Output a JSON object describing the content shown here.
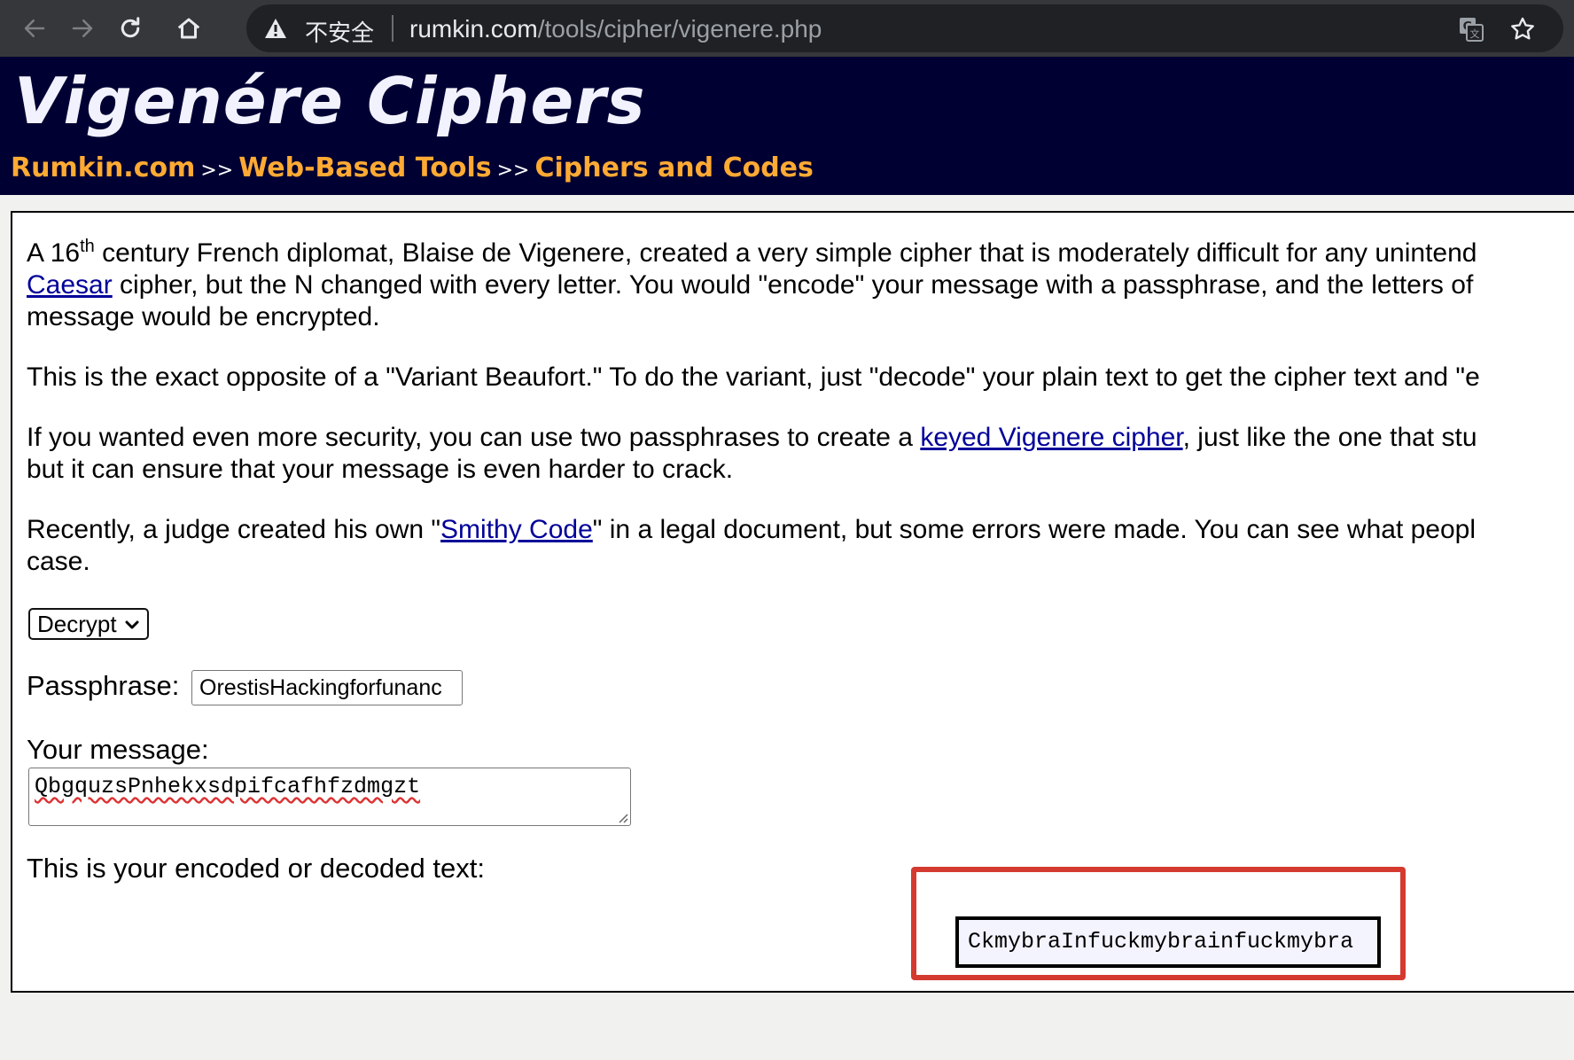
{
  "browser": {
    "security_label": "不安全",
    "url_host": "rumkin.com",
    "url_path": "/tools/cipher/vigenere.php"
  },
  "header": {
    "title": "Vigenére Ciphers",
    "breadcrumb": [
      "Rumkin.com",
      "Web-Based Tools",
      "Ciphers and Codes"
    ],
    "breadcrumb_separator": ">>"
  },
  "content": {
    "p1": {
      "a": "A 16",
      "sup": "th",
      "b": " century French diplomat, Blaise de Vigenere, created a very simple cipher that is moderately difficult for any unintend",
      "link": "Caesar",
      "c": " cipher, but the N changed with every letter. You would \"encode\" your message with a passphrase, and the letters of",
      "d": "message would be encrypted."
    },
    "p2": "This is the exact opposite of a \"Variant Beaufort.\" To do the variant, just \"decode\" your plain text to get the cipher text and \"e",
    "p3": {
      "a": "If you wanted even more security, you can use two passphrases to create a ",
      "link": "keyed Vigenere cipher",
      "b": ", just like the one that stu",
      "c": "but it can ensure that your message is even harder to crack."
    },
    "p4": {
      "a": "Recently, a judge created his own \"",
      "link": "Smithy Code",
      "b": "\" in a legal document, but some errors were made. You can see what peopl",
      "c": "case."
    }
  },
  "form": {
    "mode": "Decrypt",
    "passphrase_label": "Passphrase:",
    "passphrase_value": "OrestisHackingforfunanc",
    "message_label": "Your message:",
    "message_value": "QbgquzsPnhekxsdpifcafhfzdmgzt",
    "result_label": "This is your encoded or decoded text:",
    "result_value": "CkmybraInfuckmybrainfuckmybra"
  },
  "colors": {
    "header_bg": "#000033",
    "breadcrumb": "#ffaa33",
    "link": "#000099",
    "highlight": "#d43a2f"
  }
}
